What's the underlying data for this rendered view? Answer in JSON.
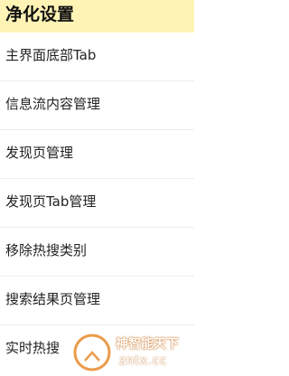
{
  "header": {
    "title": "净化设置"
  },
  "menu": {
    "items": [
      {
        "label": "主界面底部Tab"
      },
      {
        "label": "信息流内容管理"
      },
      {
        "label": "发现页管理"
      },
      {
        "label": "发现页Tab管理"
      },
      {
        "label": "移除热搜类别"
      },
      {
        "label": "搜索结果页管理"
      },
      {
        "label": "实时热搜"
      }
    ]
  },
  "watermark": {
    "line1": "神智能天下",
    "line2": "zntx.cc"
  },
  "colors": {
    "header_bg": "#fff4b5",
    "divider": "#ececec",
    "watermark_accent": "#e8892b"
  }
}
